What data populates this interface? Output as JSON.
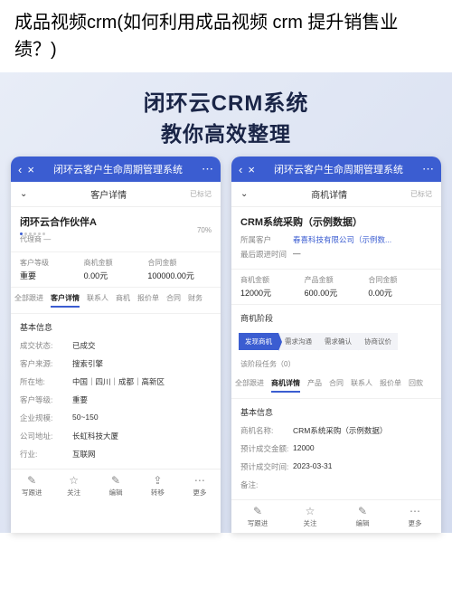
{
  "pageTitle": "成品视频crm(如何利用成品视频 crm 提升销售业绩？)",
  "hero": {
    "line1": "闭环云CRM系统",
    "line2": "教你高效整理"
  },
  "nav": {
    "title": "闭环云客户生命周期管理系统"
  },
  "left": {
    "subHeader": {
      "title": "客户详情",
      "flag": "已标记"
    },
    "customer": {
      "name": "闭环云合作伙伴A",
      "tag": "代理商",
      "percent": "70%"
    },
    "summary": [
      {
        "label": "客户等级",
        "value": "重要"
      },
      {
        "label": "商机金额",
        "value": "0.00元"
      },
      {
        "label": "合同金额",
        "value": "100000.00元"
      }
    ],
    "tabs": [
      "全部跟进",
      "客户详情",
      "联系人",
      "商机",
      "报价单",
      "合同",
      "财务"
    ],
    "activeTab": 1,
    "sectionBasic": "基本信息",
    "fields": [
      {
        "label": "成交状态:",
        "value": "已成交"
      },
      {
        "label": "客户来源:",
        "value": "搜索引擎"
      },
      {
        "label": "所在地:",
        "value": "中国｜四川｜成都｜高新区"
      },
      {
        "label": "客户等级:",
        "value": "重要"
      },
      {
        "label": "企业规模:",
        "value": "50~150"
      },
      {
        "label": "公司地址:",
        "value": "长虹科技大厦"
      },
      {
        "label": "行业:",
        "value": "互联网"
      }
    ],
    "bottomBar": [
      {
        "icon": "✎",
        "label": "写跟进"
      },
      {
        "icon": "☆",
        "label": "关注"
      },
      {
        "icon": "✎",
        "label": "编辑"
      },
      {
        "icon": "⇪",
        "label": "转移"
      },
      {
        "icon": "⋯",
        "label": "更多"
      }
    ]
  },
  "right": {
    "subHeader": {
      "title": "商机详情",
      "flag": "已标记"
    },
    "opp": {
      "name": "CRM系统采购（示例数据）",
      "ownerLabel": "所属客户",
      "ownerValue": "春喜科技有限公司（示例数...",
      "lastLabel": "最后跟进时间",
      "lastValue": "—"
    },
    "summary": [
      {
        "label": "商机金额",
        "value": "12000元"
      },
      {
        "label": "产品金额",
        "value": "600.00元"
      },
      {
        "label": "合同金额",
        "value": "0.00元"
      }
    ],
    "stageSection": "商机阶段",
    "stages": [
      "发现商机",
      "需求沟通",
      "需求确认",
      "协商议价"
    ],
    "activeStage": 0,
    "stageNote": "该阶段任务（0）",
    "tabs": [
      "全部跟进",
      "商机详情",
      "产品",
      "合同",
      "联系人",
      "报价单",
      "回款"
    ],
    "activeTab": 1,
    "sectionBasic": "基本信息",
    "fields": [
      {
        "label": "商机名称:",
        "value": "CRM系统采购（示例数据）"
      },
      {
        "label": "预计成交金额:",
        "value": "12000"
      },
      {
        "label": "预计成交时间:",
        "value": "2023-03-31"
      },
      {
        "label": "备注:",
        "value": ""
      }
    ],
    "bottomBar": [
      {
        "icon": "✎",
        "label": "写跟进"
      },
      {
        "icon": "☆",
        "label": "关注"
      },
      {
        "icon": "✎",
        "label": "编辑"
      },
      {
        "icon": "⋯",
        "label": "更多"
      }
    ]
  }
}
